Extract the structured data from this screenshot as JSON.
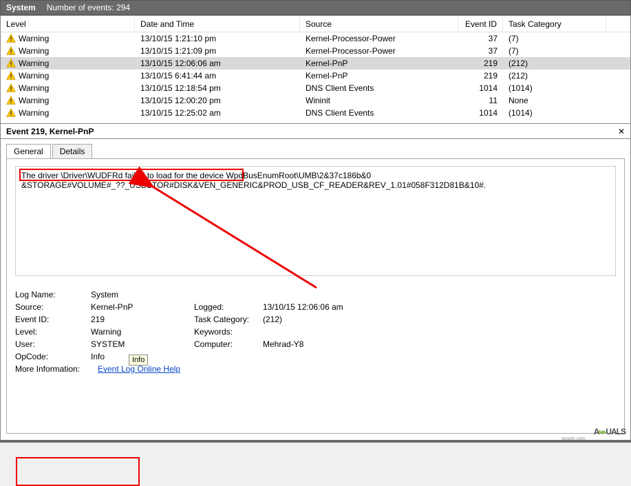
{
  "topbar": {
    "title": "System",
    "count_label": "Number of events: 294"
  },
  "columns": {
    "level": "Level",
    "date": "Date and Time",
    "source": "Source",
    "eventid": "Event ID",
    "task": "Task Category"
  },
  "rows": [
    {
      "level": "Warning",
      "date": "13/10/15 1:21:10 pm",
      "source": "Kernel-Processor-Power",
      "eventid": "37",
      "task": "(7)",
      "selected": false
    },
    {
      "level": "Warning",
      "date": "13/10/15 1:21:09 pm",
      "source": "Kernel-Processor-Power",
      "eventid": "37",
      "task": "(7)",
      "selected": false
    },
    {
      "level": "Warning",
      "date": "13/10/15 12:06:06 am",
      "source": "Kernel-PnP",
      "eventid": "219",
      "task": "(212)",
      "selected": true
    },
    {
      "level": "Warning",
      "date": "13/10/15 6:41:44 am",
      "source": "Kernel-PnP",
      "eventid": "219",
      "task": "(212)",
      "selected": false
    },
    {
      "level": "Warning",
      "date": "13/10/15 12:18:54 pm",
      "source": "DNS Client Events",
      "eventid": "1014",
      "task": "(1014)",
      "selected": false
    },
    {
      "level": "Warning",
      "date": "13/10/15 12:00:20 pm",
      "source": "Wininit",
      "eventid": "11",
      "task": "None",
      "selected": false
    },
    {
      "level": "Warning",
      "date": "13/10/15 12:25:02 am",
      "source": "DNS Client Events",
      "eventid": "1014",
      "task": "(1014)",
      "selected": false
    }
  ],
  "section": {
    "title": "Event 219, Kernel-PnP",
    "close": "✕"
  },
  "tabs": {
    "general": "General",
    "details": "Details"
  },
  "message": {
    "line1": "The driver \\Driver\\WUDFRd failed to load for the device WpdBusEnumRoot\\UMB\\2&37c186b&0",
    "line2": "&STORAGE#VOLUME#_??_USBSTOR#DISK&VEN_GENERIC&PROD_USB_CF_READER&REV_1.01#058F312D81B&10#."
  },
  "props": {
    "logname_l": "Log Name:",
    "logname_v": "System",
    "source_l": "Source:",
    "source_v": "Kernel-PnP",
    "logged_l": "Logged:",
    "logged_v": "13/10/15 12:06:06 am",
    "eventid_l": "Event ID:",
    "eventid_v": "219",
    "taskcat_l": "Task Category:",
    "taskcat_v": "(212)",
    "level_l": "Level:",
    "level_v": "Warning",
    "keywords_l": "Keywords:",
    "keywords_v": "",
    "user_l": "User:",
    "user_v": "SYSTEM",
    "computer_l": "Computer:",
    "computer_v": "Mehrad-Y8",
    "opcode_l": "OpCode:",
    "opcode_v": "Info",
    "moreinfo_l": "More Information:",
    "moreinfo_v": "Event Log Online Help"
  },
  "tooltip": "Info",
  "watermark": {
    "brand_pre": "A",
    "brand_green": "▸▸",
    "brand_post": "UALS",
    "sub": "wsxdn.com"
  }
}
